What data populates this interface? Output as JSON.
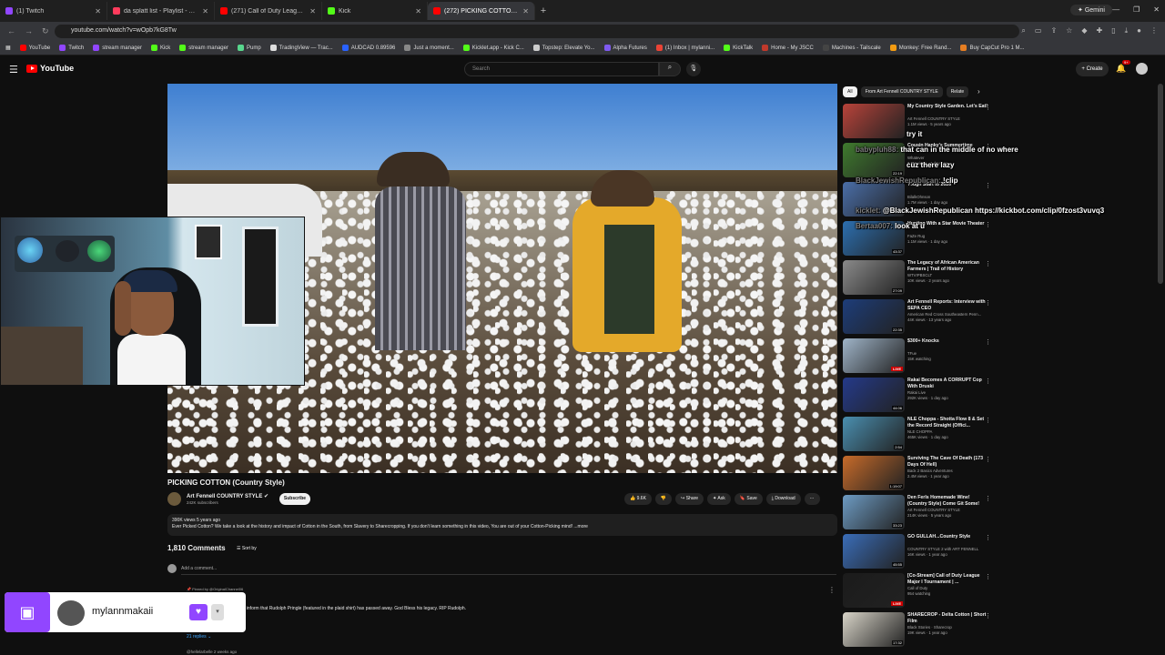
{
  "browser": {
    "tabs": [
      {
        "title": "(1) Twitch",
        "color": "#9146ff"
      },
      {
        "title": "da splatt list - Playlist - Apple",
        "color": "#ff3b5c"
      },
      {
        "title": "(271) Call of Duty League Major",
        "color": "#ff0000"
      },
      {
        "title": "Kick",
        "color": "#53fc18"
      },
      {
        "title": "(272) PICKING COTTON (Country",
        "color": "#ff0000"
      }
    ],
    "new_tab": "+",
    "gemini": "Gemini",
    "url": "youtube.com/watch?v=wOpb7kG8Tw",
    "bookmarks": [
      {
        "label": "YouTube",
        "color": "#ff0000"
      },
      {
        "label": "Twitch",
        "color": "#9146ff"
      },
      {
        "label": "stream manager",
        "color": "#9146ff"
      },
      {
        "label": "Kick",
        "color": "#53fc18"
      },
      {
        "label": "stream manager",
        "color": "#53fc18"
      },
      {
        "label": "Pump",
        "color": "#58d68d"
      },
      {
        "label": "TradingView — Trac...",
        "color": "#dddddd"
      },
      {
        "label": "AUDCAD 0.89596",
        "color": "#2962ff"
      },
      {
        "label": "Just a moment...",
        "color": "#888888"
      },
      {
        "label": "Kicklet.app - Kick C...",
        "color": "#53fc18"
      },
      {
        "label": "Topstep: Elevate Yo...",
        "color": "#cccccc"
      },
      {
        "label": "Alpha Futures",
        "color": "#7f5af0"
      },
      {
        "label": "(1) Inbox | mylanni...",
        "color": "#ea4335"
      },
      {
        "label": "KickTalk",
        "color": "#53fc18"
      },
      {
        "label": "Home - My JSCC",
        "color": "#c0392b"
      },
      {
        "label": "Machines - Tailscale",
        "color": "#444444"
      },
      {
        "label": "Monkey: Free Rand...",
        "color": "#f39c12"
      },
      {
        "label": "Buy CapCut Pro 1 M...",
        "color": "#e67e22"
      }
    ]
  },
  "youtube": {
    "logo": "YouTube",
    "search_placeholder": "Search",
    "create": "+ Create",
    "notif_count": "9+"
  },
  "video": {
    "title": "PICKING COTTON (Country Style)",
    "channel": "Art Fennell COUNTRY STYLE",
    "subscribers": "242K subscribers",
    "subscribe_label": "Subscribe",
    "likes": "9.6K",
    "share": "Share",
    "ask": "Ask",
    "save": "Save",
    "download": "Download",
    "desc_meta": "390K views  5 years ago",
    "desc_text": "Ever Picked Cotton? We take a look at the history and impact of Cotton in the South, from Slavery to Sharecropping. If you don't learn something in this video, You are out of your Cotton-Picking mind! ...more"
  },
  "comments": {
    "count": "1,810 Comments",
    "sort": "Sort by",
    "add_placeholder": "Add a comment...",
    "pinned": "Pinned by @OriginalChannel06",
    "pinned_text": "y 11, 2023. I am saddened to inform that Rudolph Pringle (featured in the plaid shirt) has passed away. God Bless his legacy. RIP Rudolph.",
    "replies": "21 replies",
    "second_user": "@hellelarbelle 2 weeks ago"
  },
  "twitch_badge": {
    "username": "mylannmakaii"
  },
  "recommendations": {
    "chips": [
      "All",
      "From Art Fennell COUNTRY STYLE",
      "Relate"
    ],
    "items": [
      {
        "title": "My Country Style Garden. Let's Eat!",
        "channel": "Art Fennell COUNTRY STYLE",
        "meta": "1.1M views · 5 years ago",
        "duration": "",
        "thumb": "#b8433a"
      },
      {
        "title": "Cousin Hanky's Summertime",
        "channel": "Whatever",
        "meta": "3.9M views · 1 day ago",
        "duration": "22:19",
        "thumb": "#3f7a2e"
      },
      {
        "title": "Tough Start to 2026",
        "channel": "BilalkOhnson",
        "meta": "1.7M views · 1 day ago",
        "duration": "",
        "thumb": "#4a6ea8"
      },
      {
        "title": "Hunting With a Star Movie Theater",
        "channel": "FaZe Rug",
        "meta": "1.1M views · 1 day ago",
        "duration": "43:37",
        "thumb": "#2c6fb0"
      },
      {
        "title": "The Legacy of African American Farmers | Trail of History",
        "channel": "WTVIPBSCLT",
        "meta": "10K views · 2 years ago",
        "duration": "27:09",
        "thumb": "#8a8a8a"
      },
      {
        "title": "Art Fennell Reports: Interview with SEPA CEO",
        "channel": "American Red Cross Southeastern Penn...",
        "meta": "44K views · 13 years ago",
        "duration": "22:35",
        "thumb": "#1d3d7a"
      },
      {
        "title": "$300+ Knocks",
        "channel": "TFue",
        "meta": "15K watching",
        "duration": "LIVE",
        "thumb": "#9fb4c8"
      },
      {
        "title": "Rakai Becomes A CORRUPT Cop With Druski",
        "channel": "Rakai Live",
        "meta": "292K views · 1 day ago",
        "duration": "44:06",
        "thumb": "#243a8a"
      },
      {
        "title": "NLE Choppa - Shotta Flow 8 & Set the Record Straight (Offici...",
        "channel": "NLE CHOPPA",
        "meta": "465K views · 1 day ago",
        "duration": "2:54",
        "thumb": "#4a8fb0"
      },
      {
        "title": "Surviving The Cave Of Death (173 Days Of Hell)",
        "channel": "Back 2 Basics Adventures",
        "meta": "2.4M views · 1 year ago",
        "duration": "1:19:07",
        "thumb": "#c76b2a"
      },
      {
        "title": "Den Ferls Homemade Wine! (Country Style) Come Git Some!",
        "channel": "Art Fennell COUNTRY STYLE",
        "meta": "214K views · 5 years ago",
        "duration": "33:23",
        "thumb": "#6d9bc3"
      },
      {
        "title": "GO GULLAH...Country Style",
        "channel": "COUNTRY STYLE 2 with ART FENNELL",
        "meta": "16K views · 1 year ago",
        "duration": "45:55",
        "thumb": "#3a6db8"
      },
      {
        "title": "[Co-Stream] Call of Duty League Major I Tournament | ...",
        "channel": "Call of Duty",
        "meta": "954 watching",
        "duration": "LIVE",
        "thumb": "#1b1b1b"
      },
      {
        "title": "SHARECROP - Delta Cotton | Short Film",
        "channel": "Black Stories · Sharecrop",
        "meta": "19K views · 1 year ago",
        "duration": "17:32",
        "thumb": "#d8d4c8"
      }
    ]
  },
  "chat": [
    {
      "text": "try it"
    },
    {
      "user": "babypluh88:",
      "text": "that can in the middle of no where"
    },
    {
      "text": "cuz there lazy"
    },
    {
      "user": "BlackJewishRepublican:",
      "text": "!clip"
    },
    {
      "user": "kicklet:",
      "text": "@BlackJewishRepublican https://kickbot.com/clip/0fzost3vuvq3"
    },
    {
      "user": "Bertaa007:",
      "text": "look at u"
    }
  ]
}
